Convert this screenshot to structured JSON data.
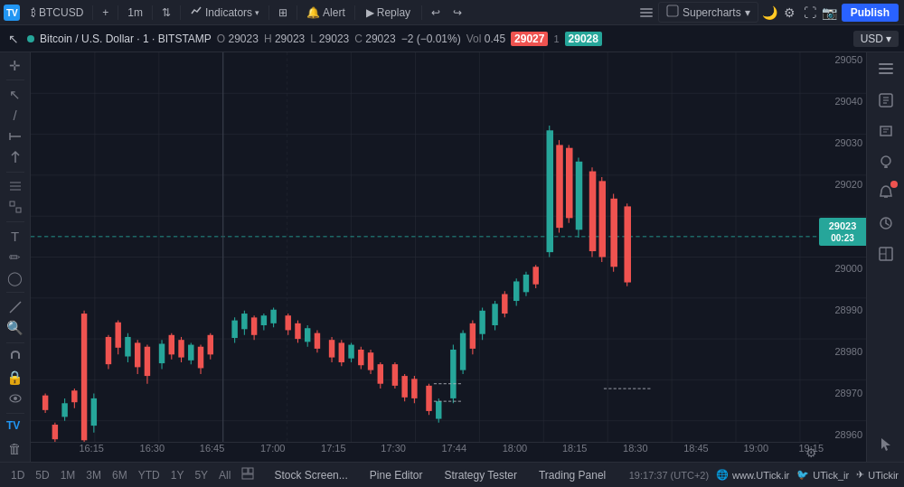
{
  "topbar": {
    "brand": "TV",
    "symbol": "BTCUSD",
    "interval": "1m",
    "compare_icon": "⇅",
    "indicators_label": "Indicators",
    "templates_icon": "⊞",
    "alert_label": "Alert",
    "replay_label": "Replay",
    "undo_icon": "↩",
    "redo_icon": "↪",
    "supercharts_label": "Supercharts",
    "publish_label": "Publish"
  },
  "symbolbar": {
    "exchange": "BITSTAMP",
    "symbol_full": "Bitcoin / U.S. Dollar · 1 · BITSTAMP",
    "o_label": "O",
    "o_val": "29023",
    "h_label": "H",
    "h_val": "29023",
    "l_label": "L",
    "l_val": "29023",
    "c_label": "C",
    "c_val": "29023",
    "change": "−2 (−0.01%)",
    "vol_label": "Vol",
    "vol_val": "0.45",
    "price_badge1": "29027",
    "price_badge2": "29028",
    "currency": "USD"
  },
  "chart": {
    "y_labels": [
      "29050",
      "29040",
      "29030",
      "29020",
      "29010",
      "29000",
      "28990",
      "28980",
      "28970",
      "28960"
    ],
    "x_labels": [
      "16:15",
      "16:30",
      "16:45",
      "17:00",
      "17:15",
      "17:30",
      "17:44",
      "18:00",
      "18:15",
      "18:30",
      "18:45",
      "19:00",
      "19:15"
    ],
    "current_price": "29023",
    "current_time": "00:23",
    "current_price_label": "29023",
    "time_zone": "19:17:37 (UTC+2)"
  },
  "bottom_bar": {
    "items": [
      "Stock Screen...",
      "Pine Editor",
      "Strategy Tester",
      "Trading Panel"
    ],
    "utick_web": "www.UTick.ir",
    "utick_twitter": "UTick_ir",
    "utick_telegram": "UTickir"
  },
  "periods": [
    "1D",
    "5D",
    "1M",
    "3M",
    "6M",
    "YTD",
    "1Y",
    "5Y",
    "All"
  ],
  "right_toolbar": {
    "icons": [
      "🔔",
      "📊",
      "📈",
      "🔍",
      "💬",
      "📡",
      "🔔",
      "⚙"
    ]
  }
}
